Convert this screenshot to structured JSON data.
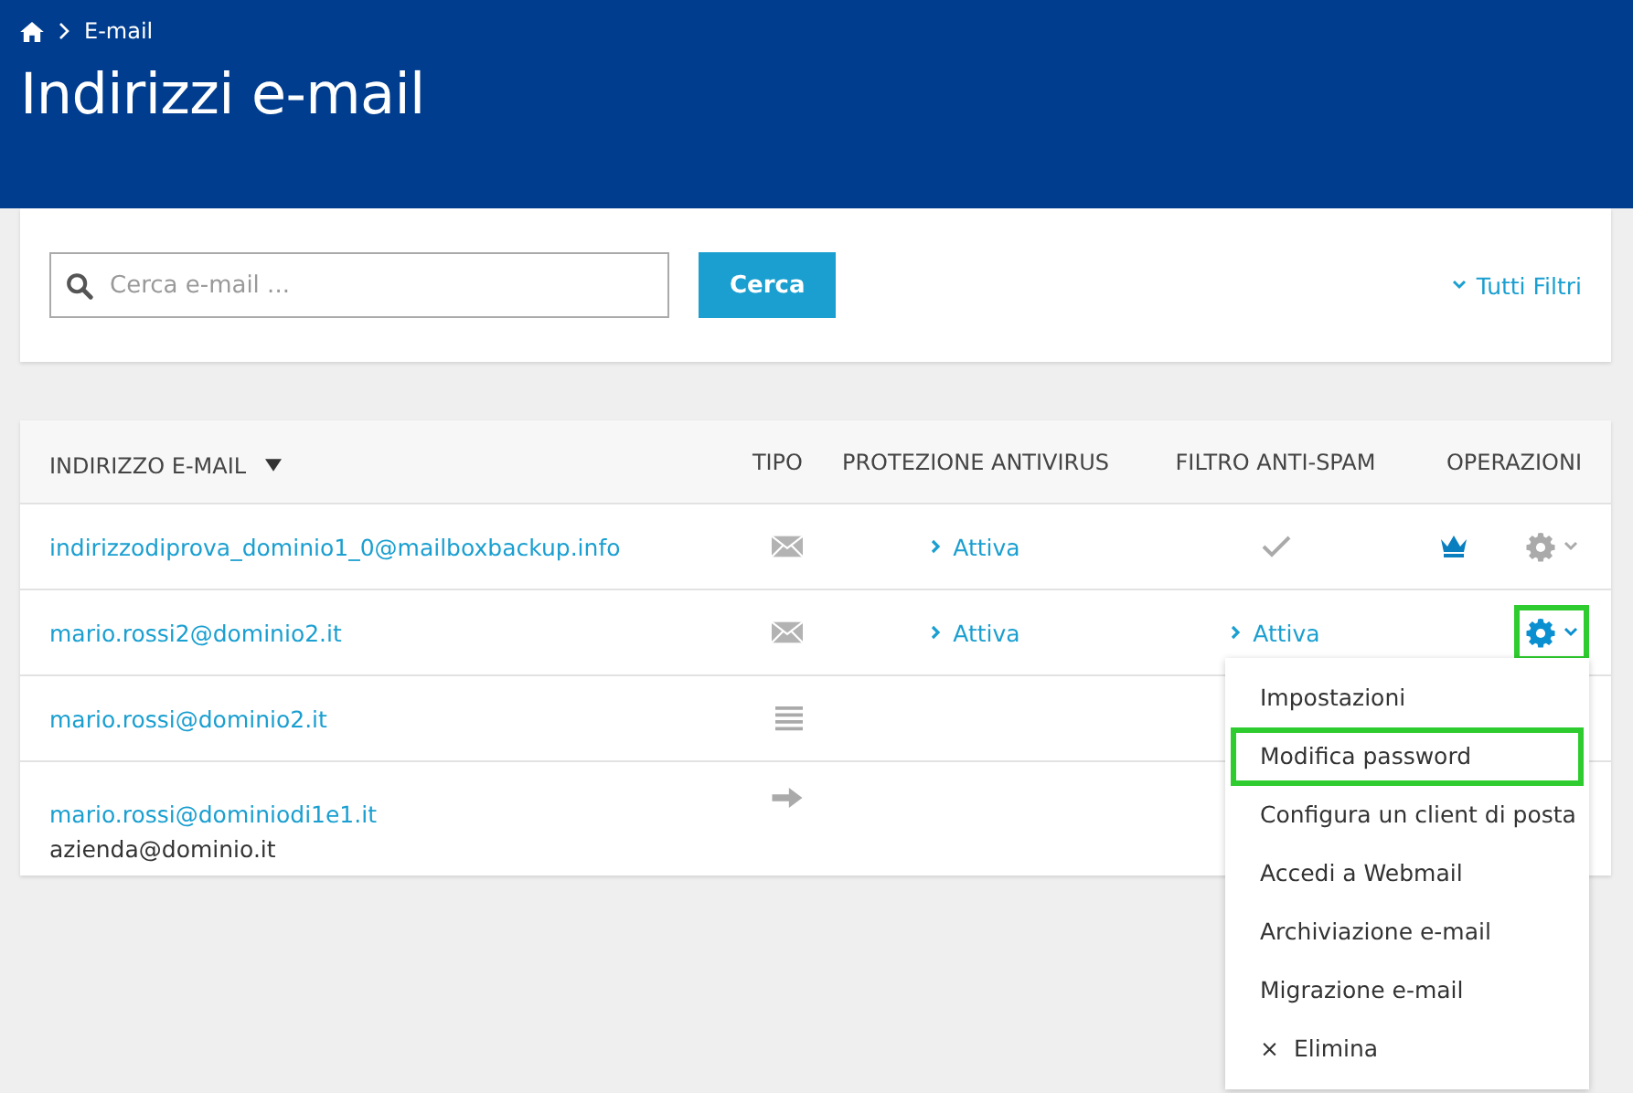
{
  "breadcrumb": {
    "current": "E-mail"
  },
  "title": "Indirizzi e-mail",
  "search": {
    "placeholder": "Cerca e-mail ...",
    "button": "Cerca",
    "filters_link": "Tutti Filtri"
  },
  "table": {
    "columns": [
      {
        "label": "INDIRIZZO E-MAIL",
        "sorted": true
      },
      {
        "label": "TIPO",
        "sorted": false
      },
      {
        "label": "PROTEZIONE ANTIVIRUS",
        "sorted": false
      },
      {
        "label": "FILTRO ANTI-SPAM",
        "sorted": false
      },
      {
        "label": "OPERAZIONI",
        "sorted": false
      }
    ],
    "rows": [
      {
        "email": "indirizzodiprova_dominio1_0@mailboxbackup.info",
        "type": {
          "kind": "mailbox"
        },
        "antivirus": "Attiva",
        "antispam": {
          "kind": "check"
        },
        "premium": true,
        "menu_open": false
      },
      {
        "email": "mario.rossi2@dominio2.it",
        "type": {
          "kind": "mailbox"
        },
        "antivirus": "Attiva",
        "antispam": {
          "kind": "link",
          "label": "Attiva"
        },
        "premium": false,
        "menu_open": true
      },
      {
        "email": "mario.rossi@dominio2.it",
        "type": {
          "kind": "list"
        }
      },
      {
        "email": "mario.rossi@dominiodi1e1.it",
        "secondary": "azienda@dominio.it",
        "type": {
          "kind": "forward"
        }
      }
    ]
  },
  "menu": [
    {
      "label": "Impostazioni",
      "highlighted": false
    },
    {
      "label": "Modifica password",
      "highlighted": true
    },
    {
      "label": "Configura un client di posta",
      "highlighted": false
    },
    {
      "label": "Accedi a Webmail",
      "highlighted": false
    },
    {
      "label": "Archiviazione e-mail",
      "highlighted": false
    },
    {
      "label": "Migrazione e-mail",
      "highlighted": false
    },
    {
      "label": "Elimina",
      "highlighted": false,
      "icon": "×"
    }
  ]
}
